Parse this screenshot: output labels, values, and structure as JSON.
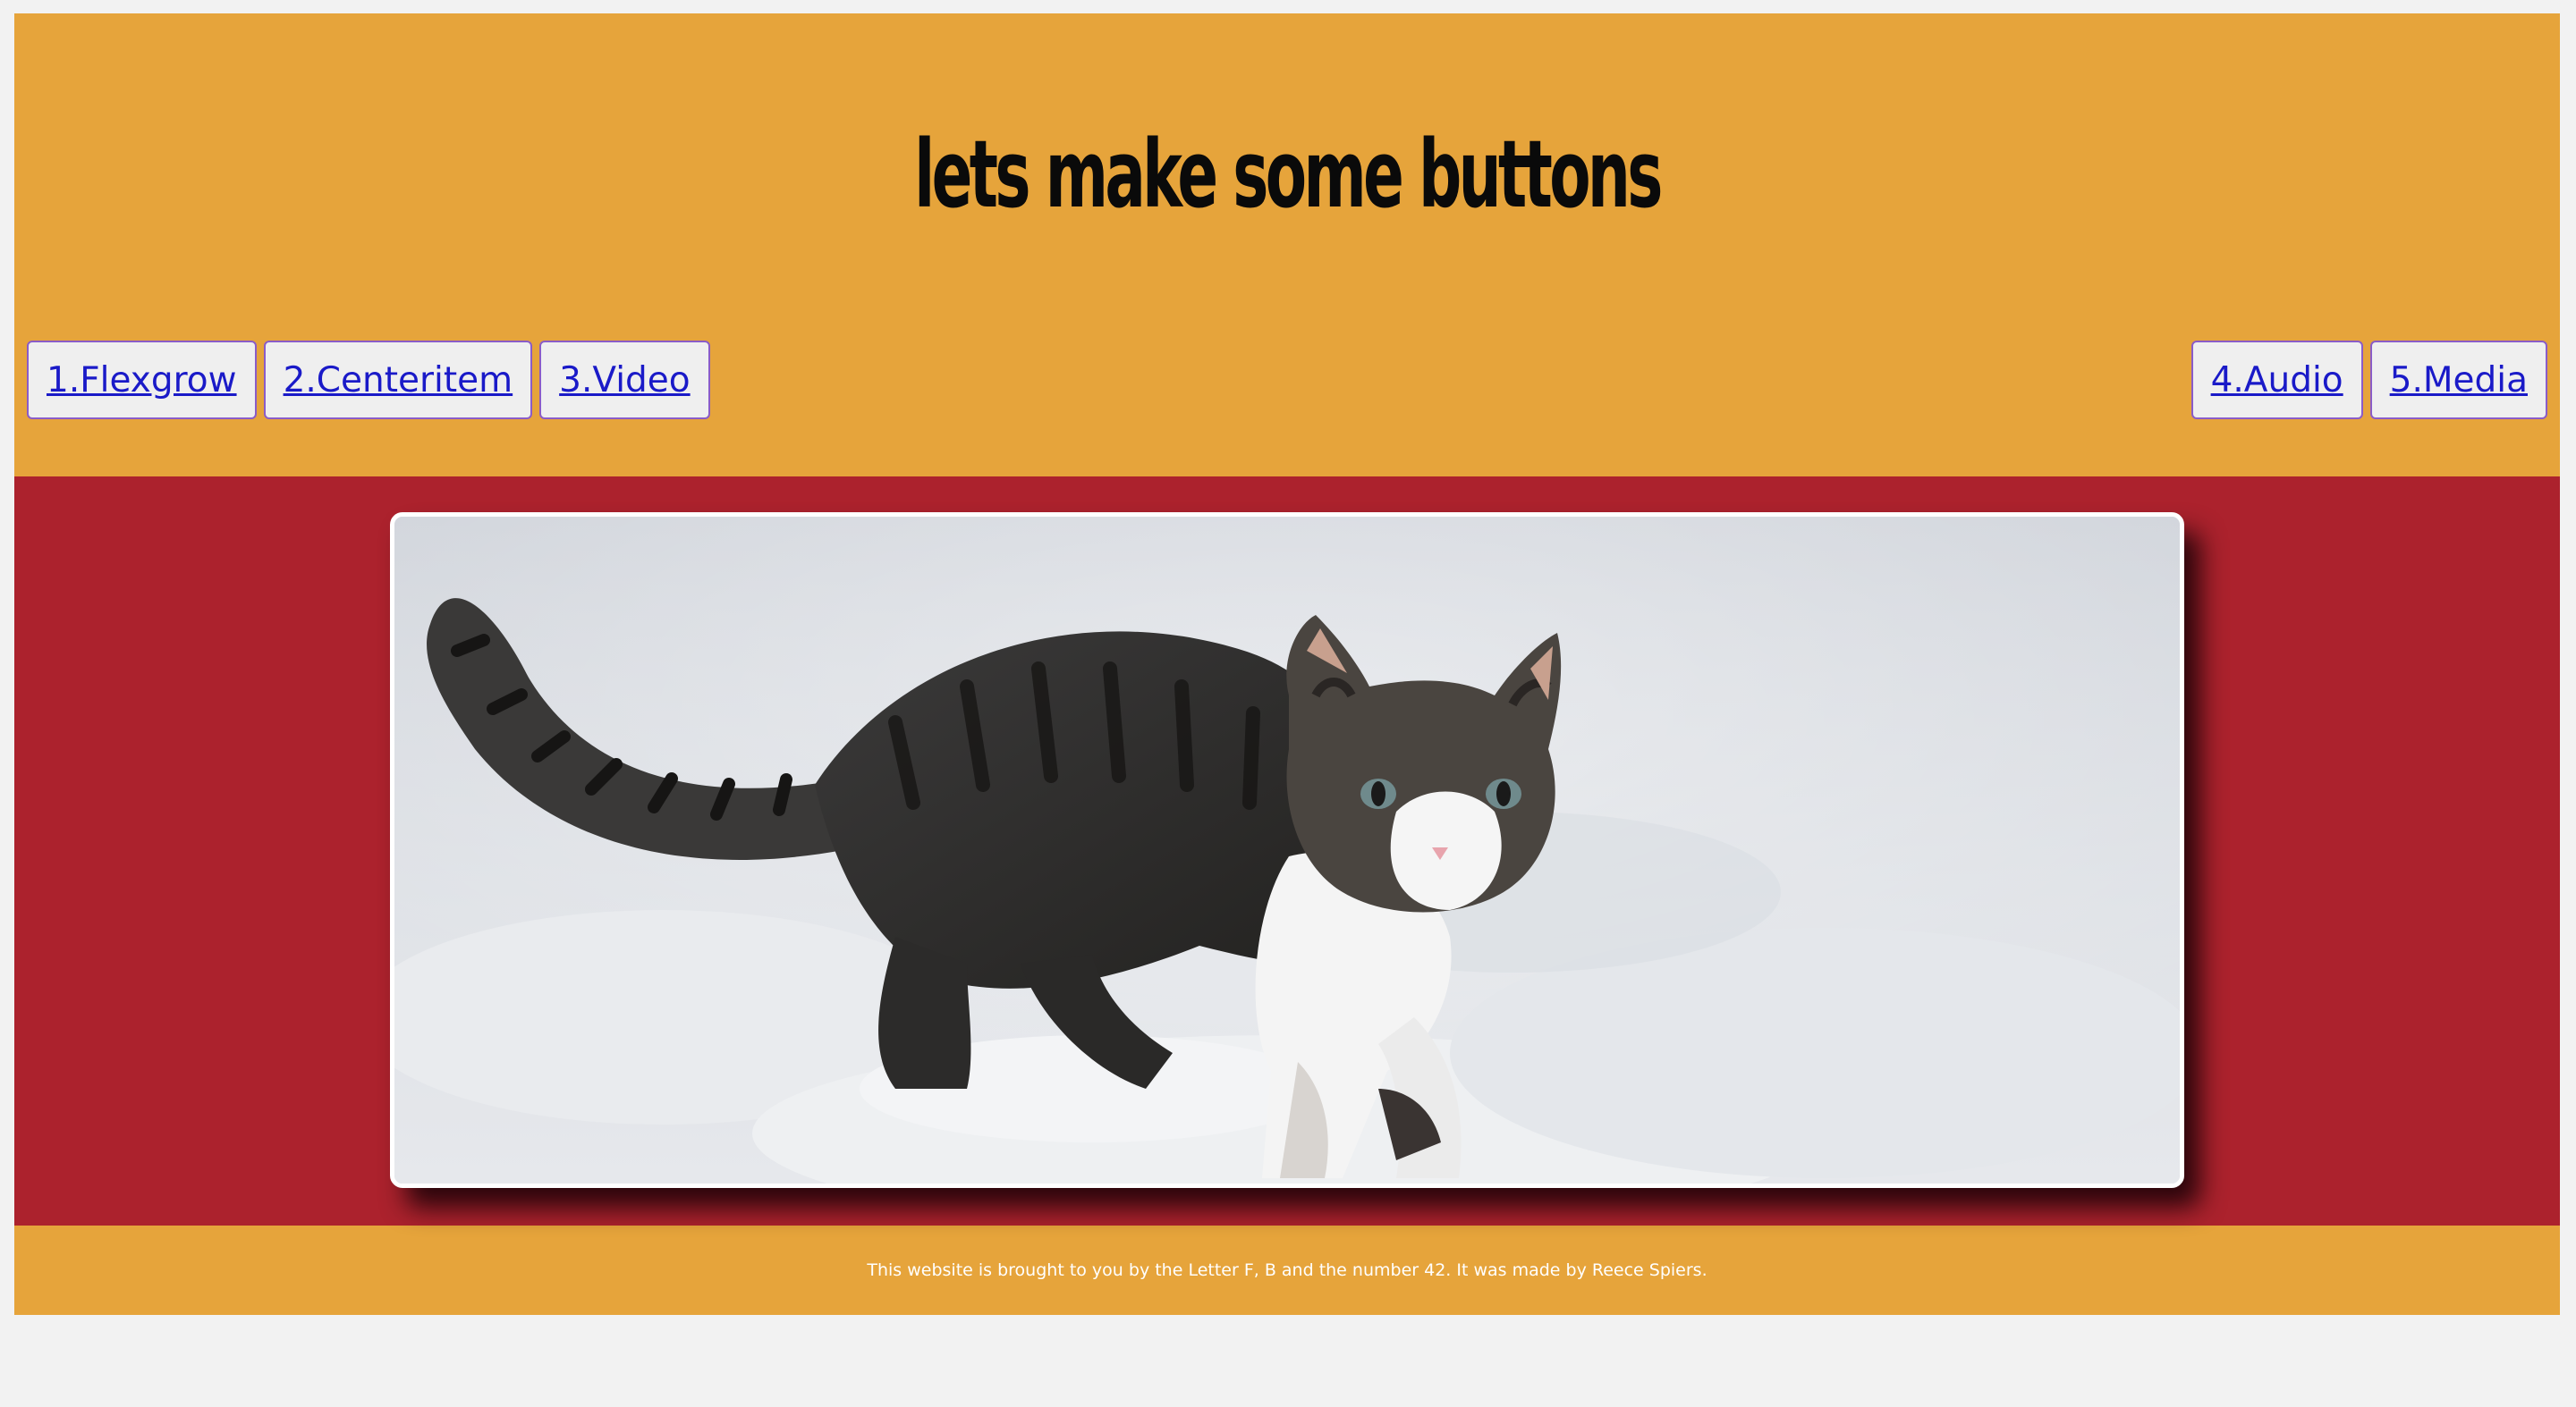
{
  "header": {
    "title": "lets make some buttons"
  },
  "nav": {
    "left": [
      {
        "label": "1.Flexgrow"
      },
      {
        "label": "2.Centeritem"
      },
      {
        "label": "3.Video"
      }
    ],
    "right": [
      {
        "label": "4.Audio"
      },
      {
        "label": "5.Media"
      }
    ],
    "link_color": "#1a1ac8"
  },
  "main": {
    "image": "kitten-in-snow-photo"
  },
  "footer": {
    "text": "This website is brought to you by the Letter F, B and the number 42. It was made by Reece Spiers."
  },
  "colors": {
    "header_bg": "#e6a43b",
    "main_bg": "#ac222d",
    "page_bg": "#f2f2f2",
    "button_border": "#8a5cc8"
  }
}
